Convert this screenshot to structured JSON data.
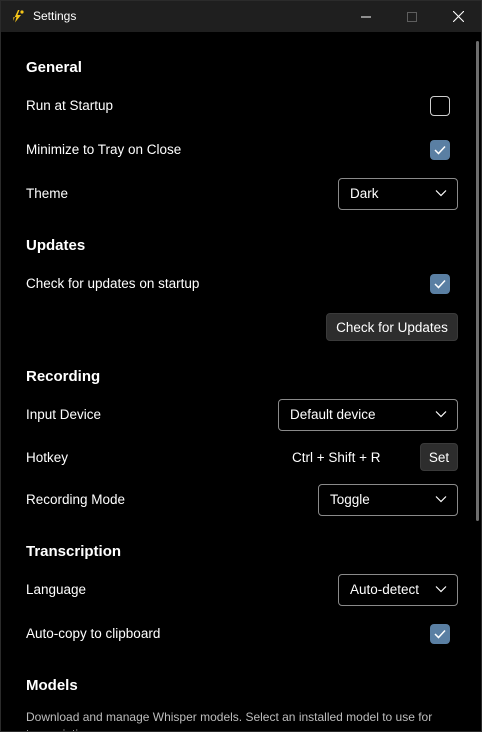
{
  "window": {
    "title": "Settings",
    "icon": "app-bolt-icon",
    "controls": {
      "minimize": "minimize-icon",
      "maximize": "maximize-icon",
      "close": "close-icon"
    }
  },
  "general": {
    "title": "General",
    "run_at_startup": {
      "label": "Run at Startup",
      "checked": false
    },
    "minimize_to_tray": {
      "label": "Minimize to Tray on Close",
      "checked": true
    },
    "theme": {
      "label": "Theme",
      "value": "Dark"
    }
  },
  "updates": {
    "title": "Updates",
    "check_on_startup": {
      "label": "Check for updates on startup",
      "checked": true
    },
    "check_button": "Check for Updates"
  },
  "recording": {
    "title": "Recording",
    "input_device": {
      "label": "Input Device",
      "value": "Default device"
    },
    "hotkey": {
      "label": "Hotkey",
      "value": "Ctrl + Shift + R",
      "set_button": "Set"
    },
    "recording_mode": {
      "label": "Recording Mode",
      "value": "Toggle"
    }
  },
  "transcription": {
    "title": "Transcription",
    "language": {
      "label": "Language",
      "value": "Auto-detect"
    },
    "auto_copy": {
      "label": "Auto-copy to clipboard",
      "checked": true
    }
  },
  "models": {
    "title": "Models",
    "description": "Download and manage Whisper models. Select an installed model to use for transcription."
  },
  "colors": {
    "background": "#000000",
    "titlebar": "#1f1f1f",
    "checkbox_accent": "#5a7fa3",
    "button_bg": "#2d2d2d",
    "app_icon": "#f5c518"
  }
}
